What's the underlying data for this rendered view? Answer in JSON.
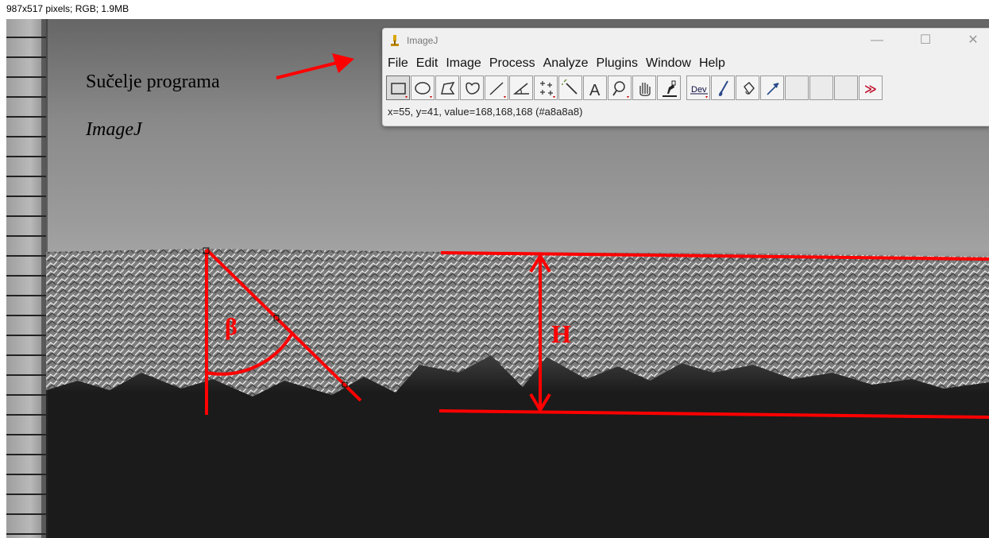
{
  "image_info": "987x517 pixels; RGB; 1.9MB",
  "caption": {
    "line1": "Sučelje programa",
    "line2": "ImageJ"
  },
  "annotations": {
    "angle_symbol": "β",
    "height_symbol": "H",
    "overlay_color": "#ff0000"
  },
  "imagej": {
    "title": "ImageJ",
    "window_controls": [
      "—",
      "☐",
      "✕"
    ],
    "menu": [
      "File",
      "Edit",
      "Image",
      "Process",
      "Analyze",
      "Plugins",
      "Window",
      "Help"
    ],
    "tools": [
      {
        "icon": "rectangle-tool-icon"
      },
      {
        "icon": "oval-tool-icon"
      },
      {
        "icon": "polygon-tool-icon"
      },
      {
        "icon": "freehand-tool-icon"
      },
      {
        "icon": "line-tool-icon"
      },
      {
        "icon": "angle-tool-icon"
      },
      {
        "icon": "multipoint-tool-icon"
      },
      {
        "icon": "wand-tool-icon"
      },
      {
        "icon": "text-tool-icon"
      },
      {
        "icon": "magnifier-tool-icon"
      },
      {
        "icon": "hand-tool-icon"
      },
      {
        "icon": "dropper-tool-icon"
      },
      {
        "icon": "developer-menu-icon",
        "label": "Dev"
      },
      {
        "icon": "brush-tool-icon"
      },
      {
        "icon": "flood-fill-tool-icon"
      },
      {
        "icon": "arrow-tool-icon"
      },
      {
        "icon": "more-tools-icon",
        "label": "≫"
      }
    ],
    "status": "x=55, y=41, value=168,168,168 (#a8a8a8)"
  }
}
